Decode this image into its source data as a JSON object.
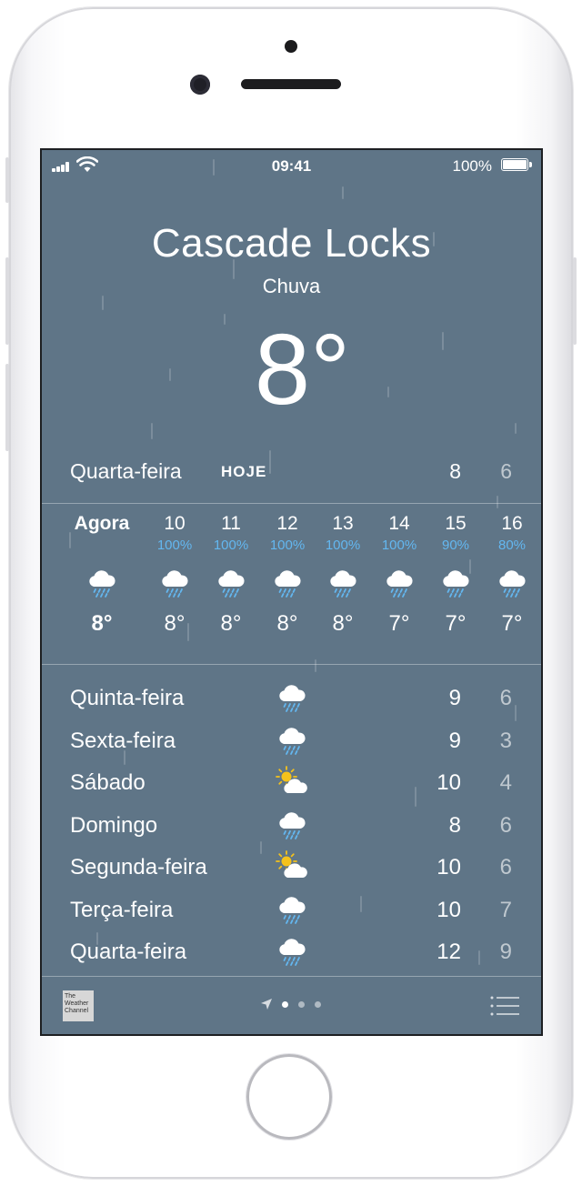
{
  "status_bar": {
    "time": "09:41",
    "battery": "100%"
  },
  "location": {
    "city": "Cascade Locks",
    "condition": "Chuva",
    "temperature": "8°"
  },
  "today": {
    "day": "Quarta-feira",
    "tag": "HOJE",
    "high": "8",
    "low": "6"
  },
  "hourly": [
    {
      "label": "Agora",
      "pop": "",
      "icon": "rain-cloud-icon",
      "temp": "8°"
    },
    {
      "label": "10",
      "pop": "100%",
      "icon": "rain-cloud-icon",
      "temp": "8°"
    },
    {
      "label": "11",
      "pop": "100%",
      "icon": "rain-cloud-icon",
      "temp": "8°"
    },
    {
      "label": "12",
      "pop": "100%",
      "icon": "rain-cloud-icon",
      "temp": "8°"
    },
    {
      "label": "13",
      "pop": "100%",
      "icon": "rain-cloud-icon",
      "temp": "8°"
    },
    {
      "label": "14",
      "pop": "100%",
      "icon": "rain-cloud-icon",
      "temp": "7°"
    },
    {
      "label": "15",
      "pop": "90%",
      "icon": "rain-cloud-icon",
      "temp": "7°"
    },
    {
      "label": "16",
      "pop": "80%",
      "icon": "rain-cloud-icon",
      "temp": "7°"
    }
  ],
  "daily": [
    {
      "day": "Quinta-feira",
      "icon": "rain-cloud-icon",
      "high": "9",
      "low": "6"
    },
    {
      "day": "Sexta-feira",
      "icon": "rain-cloud-icon",
      "high": "9",
      "low": "3"
    },
    {
      "day": "Sábado",
      "icon": "partly-sunny-icon",
      "high": "10",
      "low": "4"
    },
    {
      "day": "Domingo",
      "icon": "rain-cloud-icon",
      "high": "8",
      "low": "6"
    },
    {
      "day": "Segunda-feira",
      "icon": "partly-sunny-icon",
      "high": "10",
      "low": "6"
    },
    {
      "day": "Terça-feira",
      "icon": "rain-cloud-icon",
      "high": "10",
      "low": "7"
    },
    {
      "day": "Quarta-feira",
      "icon": "rain-cloud-icon",
      "high": "12",
      "low": "9"
    }
  ],
  "bottom_bar": {
    "logo": [
      "The",
      "Weather",
      "Channel"
    ],
    "page_count": 3,
    "active_page": 0
  },
  "colors": {
    "background": "#5f7587",
    "precip": "#63b7f0"
  }
}
